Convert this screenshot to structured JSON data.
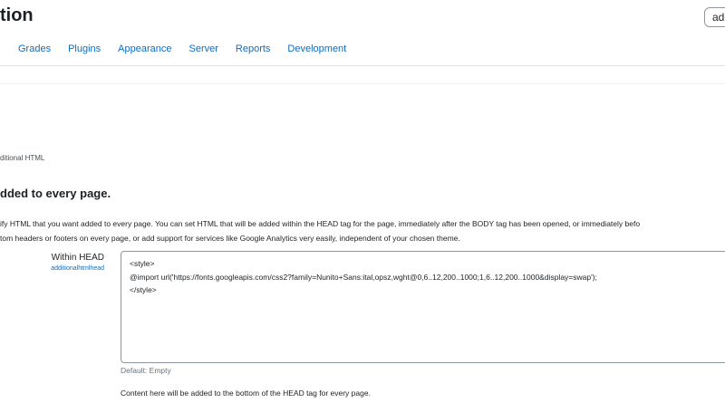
{
  "header": {
    "title_fragment": "tion",
    "search_value": "adc"
  },
  "nav": {
    "tabs": [
      {
        "label": "Grades"
      },
      {
        "label": "Plugins"
      },
      {
        "label": "Appearance"
      },
      {
        "label": "Server"
      },
      {
        "label": "Reports"
      },
      {
        "label": "Development"
      }
    ]
  },
  "breadcrumb": {
    "text": "ditional HTML"
  },
  "section": {
    "title": "dded to every page.",
    "description_lines": [
      "ify HTML that you want added to every page. You can set HTML that will be added within the HEAD tag for the page, immediately after the BODY tag has been opened, or immediately befo",
      "tom headers or footers on every page, or add support for services like Google Analytics very easily, independent of your chosen theme."
    ]
  },
  "setting": {
    "label": "Within HEAD",
    "key": "additionalhtmlhead",
    "value": "<style>\n@import url('https://fonts.googleapis.com/css2?family=Nunito+Sans:ital,opsz,wght@0,6..12,200..1000;1,6..12,200..1000&display=swap');\n</style>",
    "default_text": "Default: Empty",
    "help_text": "Content here will be added to the bottom of the HEAD tag for every page."
  }
}
